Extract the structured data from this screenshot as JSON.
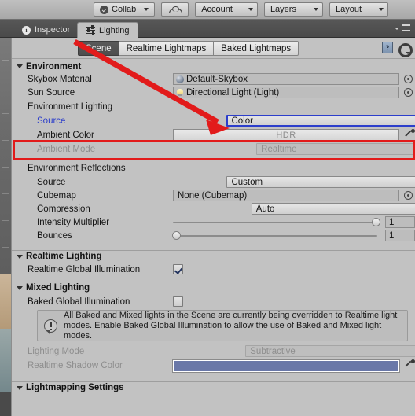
{
  "toolbar": {
    "collab": "Collab",
    "cloud_icon": "cloud-icon",
    "account": "Account",
    "layers": "Layers",
    "layout": "Layout"
  },
  "window_tabs": {
    "inspector": "Inspector",
    "lighting": "Lighting",
    "menu_icon": "hamburger-menu-icon"
  },
  "panel": {
    "tabs": [
      "Scene",
      "Realtime Lightmaps",
      "Baked Lightmaps"
    ],
    "selected_tab": "Scene",
    "help_icon": "help-book-icon",
    "gear_icon": "gear-icon"
  },
  "sections": {
    "environment": {
      "title": "Environment",
      "skybox_material": {
        "label": "Skybox Material",
        "value": "Default-Skybox",
        "icon": "material-sphere-icon"
      },
      "sun_source": {
        "label": "Sun Source",
        "value": "Directional Light (Light)",
        "icon": "light-bulb-icon"
      },
      "environment_lighting": {
        "group": "Environment Lighting",
        "source": {
          "label": "Source",
          "value": "Color"
        },
        "ambient_color": {
          "label": "Ambient Color",
          "value": "HDR"
        },
        "ambient_mode": {
          "label": "Ambient Mode",
          "value": "Realtime"
        }
      },
      "environment_reflections": {
        "group": "Environment Reflections",
        "source": {
          "label": "Source",
          "value": "Custom"
        },
        "cubemap": {
          "label": "Cubemap",
          "value": "None (Cubemap)"
        },
        "compression": {
          "label": "Compression",
          "value": "Auto"
        },
        "intensity_multiplier": {
          "label": "Intensity Multiplier",
          "value": "1",
          "slider_pct": 100
        },
        "bounces": {
          "label": "Bounces",
          "value": "1",
          "slider_pct": 0
        }
      }
    },
    "realtime_lighting": {
      "title": "Realtime Lighting",
      "realtime_gi": {
        "label": "Realtime Global Illumination",
        "checked": true
      }
    },
    "mixed_lighting": {
      "title": "Mixed Lighting",
      "baked_gi": {
        "label": "Baked Global Illumination",
        "checked": false
      },
      "helpbox": "All Baked and Mixed lights in the Scene are currently being overridden to Realtime light modes. Enable Baked Global Illumination to allow the use of Baked and Mixed light modes.",
      "lighting_mode": {
        "label": "Lighting Mode",
        "value": "Subtractive"
      },
      "realtime_shadow_color": {
        "label": "Realtime Shadow Color",
        "swatch": "#6a78a8"
      }
    },
    "lightmapping_settings": {
      "title": "Lightmapping Settings"
    }
  },
  "annotation": {
    "arrow_color": "#e21b1b",
    "box_color": "#e21b1b",
    "arrow_target": "environment-lighting-source-popup",
    "box_target": "ambient-color-row"
  }
}
